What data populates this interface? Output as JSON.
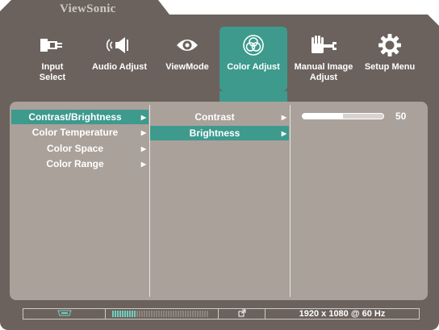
{
  "brand": "ViewSonic",
  "tabs": [
    {
      "id": "input-select",
      "label": "Input\nSelect",
      "icon": "input-select-icon",
      "active": false
    },
    {
      "id": "audio-adjust",
      "label": "Audio Adjust",
      "icon": "speaker-icon",
      "active": false
    },
    {
      "id": "viewmode",
      "label": "ViewMode",
      "icon": "eye-icon",
      "active": false
    },
    {
      "id": "color-adjust",
      "label": "Color Adjust",
      "icon": "color-circles-icon",
      "active": true
    },
    {
      "id": "manual-image-adjust",
      "label": "Manual Image\nAdjust",
      "icon": "hand-wrench-icon",
      "active": false
    },
    {
      "id": "setup-menu",
      "label": "Setup Menu",
      "icon": "gear-icon",
      "active": false
    }
  ],
  "menu_level1": [
    {
      "label": "Contrast/Brightness",
      "selected": true
    },
    {
      "label": "Color Temperature",
      "selected": false
    },
    {
      "label": "Color Space",
      "selected": false
    },
    {
      "label": "Color Range",
      "selected": false
    }
  ],
  "menu_level2": [
    {
      "label": "Contrast",
      "selected": false
    },
    {
      "label": "Brightness",
      "selected": true
    }
  ],
  "slider": {
    "value": "50",
    "fraction": 0.5
  },
  "status": {
    "resolution": "1920 x 1080 @ 60 Hz",
    "meter_fraction": 0.25,
    "connection_icon": "hdmi-icon",
    "link_icon": "external-link-icon"
  },
  "colors": {
    "accent": "#3d9a8d",
    "shell": "#6b625d",
    "panel": "#aaa19b"
  }
}
